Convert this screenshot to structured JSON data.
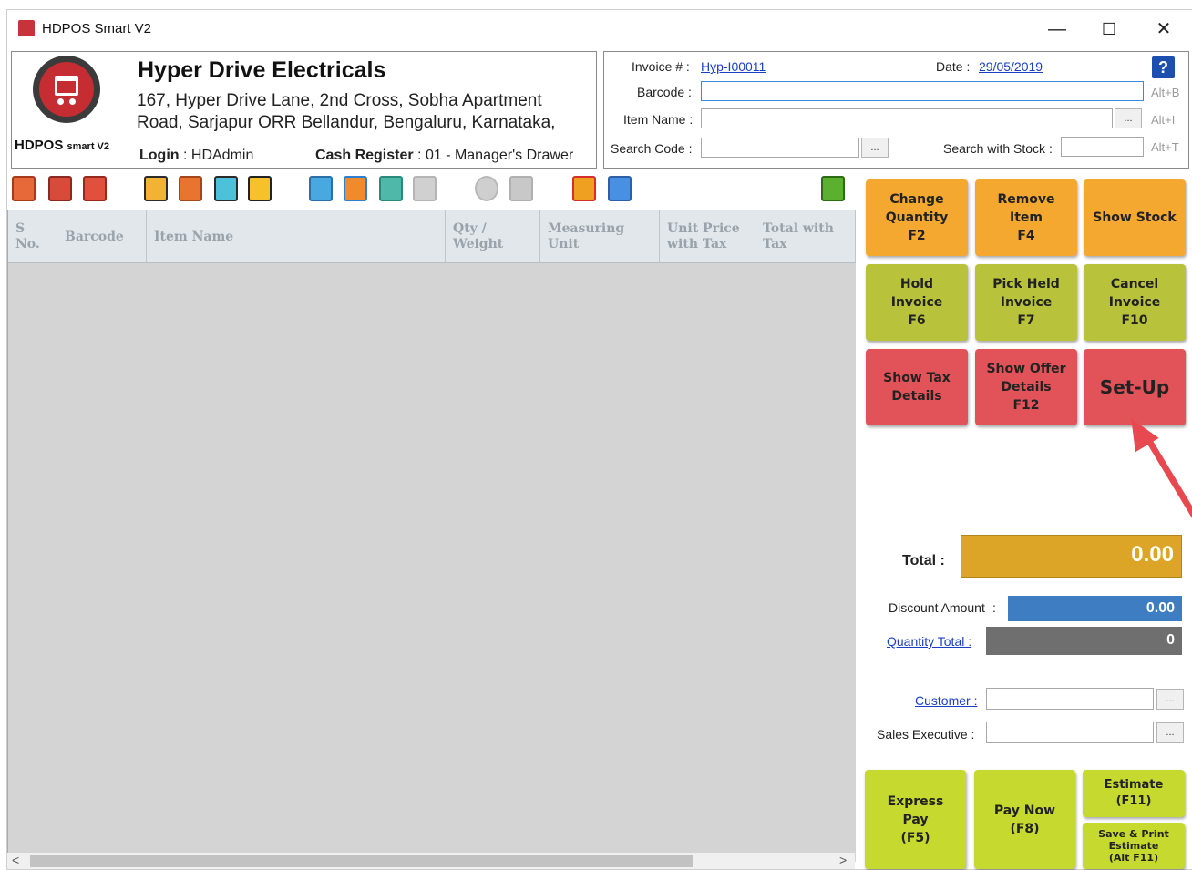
{
  "window": {
    "title": "HDPOS Smart V2",
    "minimize": "—",
    "maximize": "☐",
    "close": "✕"
  },
  "store": {
    "name": "Hyper Drive Electricals",
    "address_line1": "167, Hyper Drive Lane, 2nd Cross, Sobha Apartment",
    "address_line2": "Road, Sarjapur ORR Bellandur, Bengaluru, Karnataka,",
    "brand": "HDPOS",
    "brand_suffix": "smart V2",
    "login_label": "Login",
    "login_value": "HDAdmin",
    "cash_label": "Cash Register",
    "cash_value": "01 - Manager's Drawer"
  },
  "invoice": {
    "invoice_label": "Invoice # :",
    "invoice_value": "Hyp-I00011",
    "date_label": "Date :",
    "date_value": "29/05/2019",
    "help": "?",
    "barcode_label": "Barcode :",
    "barcode_hint": "Alt+B",
    "item_name_label": "Item Name :",
    "item_name_hint": "Alt+I",
    "search_code_label": "Search Code :",
    "search_stock_label": "Search with Stock :",
    "search_stock_hint": "Alt+T",
    "browse": "..."
  },
  "grid": {
    "columns": [
      {
        "line1": "S",
        "line2": "No."
      },
      {
        "line1": "Barcode",
        "line2": ""
      },
      {
        "line1": "Item Name",
        "line2": ""
      },
      {
        "line1": "Qty /",
        "line2": "Weight"
      },
      {
        "line1": "Measuring",
        "line2": "Unit"
      },
      {
        "line1": "Unit Price",
        "line2": "with Tax"
      },
      {
        "line1": "Total with",
        "line2": "Tax"
      }
    ],
    "scroll_left": "<",
    "scroll_right": ">"
  },
  "functions": {
    "change_qty": [
      "Change",
      "Quantity",
      "F2"
    ],
    "remove_item": [
      "Remove",
      "Item",
      "F4"
    ],
    "show_stock": [
      "Show Stock"
    ],
    "hold_invoice": [
      "Hold",
      "Invoice",
      "F6"
    ],
    "pick_held": [
      "Pick Held",
      "Invoice",
      "F7"
    ],
    "cancel_invoice": [
      "Cancel",
      "Invoice",
      "F10"
    ],
    "show_tax": [
      "Show Tax",
      "Details"
    ],
    "show_offer": [
      "Show Offer",
      "Details",
      "F12"
    ],
    "setup": [
      "Set-Up"
    ],
    "express_pay": [
      "Express",
      "Pay",
      "(F5)"
    ],
    "pay_now": [
      "Pay Now",
      "(F8)"
    ],
    "estimate": [
      "Estimate",
      "(F11)"
    ],
    "save_print": [
      "Save & Print",
      "Estimate",
      "(Alt F11)"
    ]
  },
  "totals": {
    "total_label": "Total :",
    "total_value": "0.00",
    "discount_label": "Discount Amount",
    "discount_sep": ":",
    "discount_value": "0.00",
    "qty_total_label": "Quantity Total :",
    "qty_total_value": "0"
  },
  "customer": {
    "customer_label": "Customer :",
    "sales_exec_label": "Sales Executive :",
    "browse": "..."
  },
  "colors": {
    "orange": "#f5a830",
    "olive": "#b8c23a",
    "red": "#e25259",
    "lime": "#c6d92e",
    "total_bg": "#dca527",
    "discount_bg": "#3f7dc3",
    "qty_bg": "#6f6f6f",
    "arrow": "#e8484f"
  }
}
